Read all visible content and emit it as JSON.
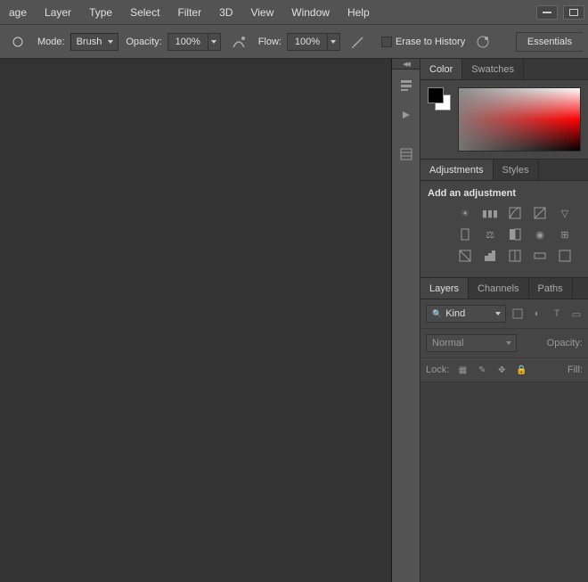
{
  "menu": [
    "age",
    "Layer",
    "Type",
    "Select",
    "Filter",
    "3D",
    "View",
    "Window",
    "Help"
  ],
  "options": {
    "mode_label": "Mode:",
    "mode_value": "Brush",
    "opacity_label": "Opacity:",
    "opacity_value": "100%",
    "flow_label": "Flow:",
    "flow_value": "100%",
    "erase_history_label": "Erase to History",
    "essentials_label": "Essentials"
  },
  "color_tabs": [
    "Color",
    "Swatches"
  ],
  "adjustments_tabs": [
    "Adjustments",
    "Styles"
  ],
  "adjustments": {
    "heading": "Add an adjustment"
  },
  "layers_tabs": [
    "Layers",
    "Channels",
    "Paths"
  ],
  "layers": {
    "kind_label": "Kind",
    "blend_mode": "Normal",
    "opacity_label": "Opacity:",
    "lock_label": "Lock:",
    "fill_label": "Fill:"
  }
}
